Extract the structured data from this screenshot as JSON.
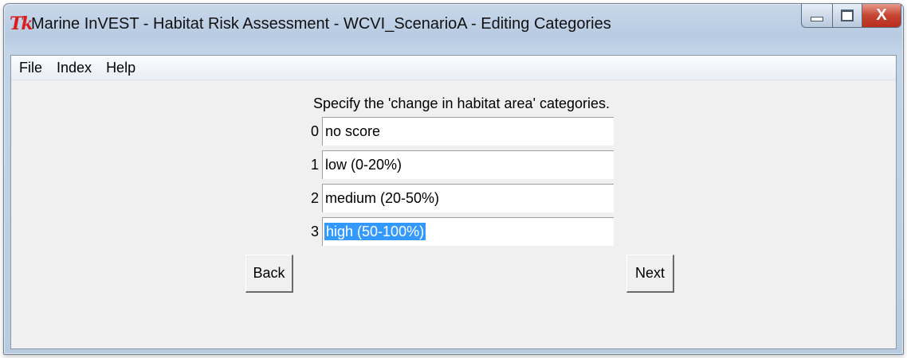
{
  "window": {
    "title": "Marine InVEST - Habitat Risk Assessment - WCVI_ScenarioA - Editing Categories",
    "app_icon": "Tk",
    "controls": {
      "minimize_icon": "minimize-icon",
      "maximize_icon": "maximize-icon",
      "close_label": "X"
    }
  },
  "menu": {
    "items": [
      {
        "label": "File"
      },
      {
        "label": "Index"
      },
      {
        "label": "Help"
      }
    ]
  },
  "main": {
    "prompt": "Specify the 'change in habitat area' categories.",
    "categories": [
      {
        "index": "0",
        "value": "no score"
      },
      {
        "index": "1",
        "value": "low (0-20%)"
      },
      {
        "index": "2",
        "value": "medium (20-50%)"
      },
      {
        "index": "3",
        "value": "high (50-100%)",
        "selected": true
      }
    ],
    "back_label": "Back",
    "next_label": "Next"
  },
  "colors": {
    "selection": "#3399ff",
    "tk_icon": "#d81e1e",
    "close_button": "#c54431"
  }
}
